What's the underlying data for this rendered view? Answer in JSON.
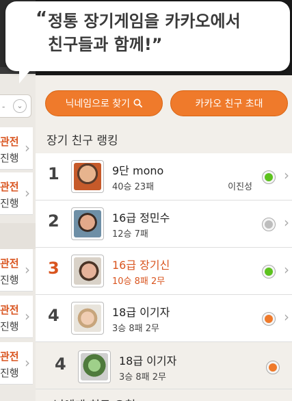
{
  "bubble": {
    "line1": "정통 장기게임을 카카오에서",
    "line2": "친구들과 함께!",
    "quote_open": "“",
    "quote_close": "”"
  },
  "buttons": {
    "nickname_search": "닉네임으로 찾기",
    "invite_kakao": "카카오 친구 초대"
  },
  "section_title": "장기 친구 랭킹",
  "ranking": [
    {
      "rank": "1",
      "name": "9단 mono",
      "record": "40승 23패",
      "extra": "이진성",
      "status": "online",
      "highlight": false
    },
    {
      "rank": "2",
      "name": "16급 정민수",
      "record": "12승 7패",
      "extra": "",
      "status": "offline",
      "highlight": false
    },
    {
      "rank": "3",
      "name": "16급 장기신",
      "record": "10승 8패 2무",
      "extra": "",
      "status": "online",
      "highlight": true
    },
    {
      "rank": "4",
      "name": "18급 이기자",
      "record": "3승 8패 2무",
      "extra": "",
      "status": "busy",
      "highlight": false
    },
    {
      "rank": "4",
      "name": "18급 이기자",
      "record": "3승 8패 2무",
      "extra": "",
      "status": "busy",
      "highlight": false
    }
  ],
  "footer_partial": "님에게 친구 요청",
  "left_panel": {
    "search_dash": "-",
    "items": [
      {
        "l1": "관전",
        "l2": "진행"
      },
      {
        "l1": "관전",
        "l2": "진행"
      },
      {
        "l1": "관전",
        "l2": "진행"
      },
      {
        "l1": "관전",
        "l2": "진행"
      },
      {
        "l1": "관전",
        "l2": "진행"
      }
    ]
  },
  "colors": {
    "accent": "#ef7a2b",
    "highlight": "#d9541e",
    "online": "#5dc21e",
    "offline": "#bdbdbd",
    "busy": "#ef7a2b"
  }
}
